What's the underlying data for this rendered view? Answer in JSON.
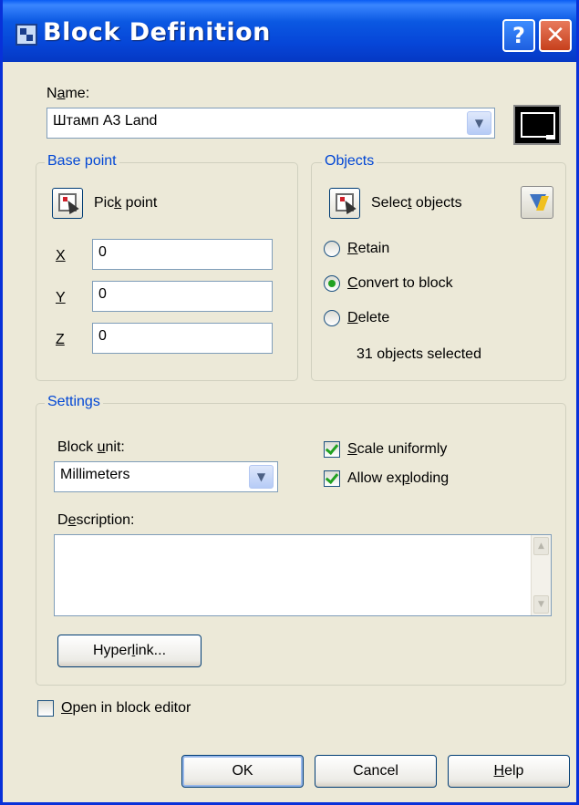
{
  "window": {
    "title": "Block Definition",
    "help_glyph": "?",
    "close_glyph": "✕"
  },
  "name": {
    "label_pre": "N",
    "label_accel": "a",
    "label_post": "me:",
    "value": "Штамп А3 Land"
  },
  "base_point": {
    "group_title": "Base point",
    "pick_pre": "Pic",
    "pick_accel": "k",
    "pick_post": " point",
    "x_label": "X",
    "y_label": "Y",
    "z_label": "Z",
    "x_value": "0",
    "y_value": "0",
    "z_value": "0"
  },
  "objects": {
    "group_title": "Objects",
    "select_pre": "Selec",
    "select_accel": "t",
    "select_post": " objects",
    "retain_accel": "R",
    "retain_post": "etain",
    "convert_accel": "C",
    "convert_post": "onvert to block",
    "delete_accel": "D",
    "delete_post": "elete",
    "selected_option": "convert",
    "status": "31 objects selected"
  },
  "settings": {
    "group_title": "Settings",
    "unit_pre": "Block ",
    "unit_accel": "u",
    "unit_post": "nit:",
    "unit_value": "Millimeters",
    "scale_accel": "S",
    "scale_post": "cale uniformly",
    "scale_checked": true,
    "explode_pre": "Allow ex",
    "explode_accel": "p",
    "explode_post": "loding",
    "explode_checked": true,
    "desc_pre": "D",
    "desc_accel": "e",
    "desc_post": "scription:",
    "description": "",
    "hyper_pre": "Hyper",
    "hyper_accel": "l",
    "hyper_post": "ink..."
  },
  "open_editor": {
    "accel": "O",
    "post": "pen in block editor",
    "checked": false
  },
  "buttons": {
    "ok": "OK",
    "cancel": "Cancel",
    "help_accel": "H",
    "help_post": "elp"
  },
  "colors": {
    "title_bar": "#0a5df4",
    "group_title": "#0046d5",
    "dialog_bg": "#ece9d8",
    "check_mark": "#21a121"
  }
}
